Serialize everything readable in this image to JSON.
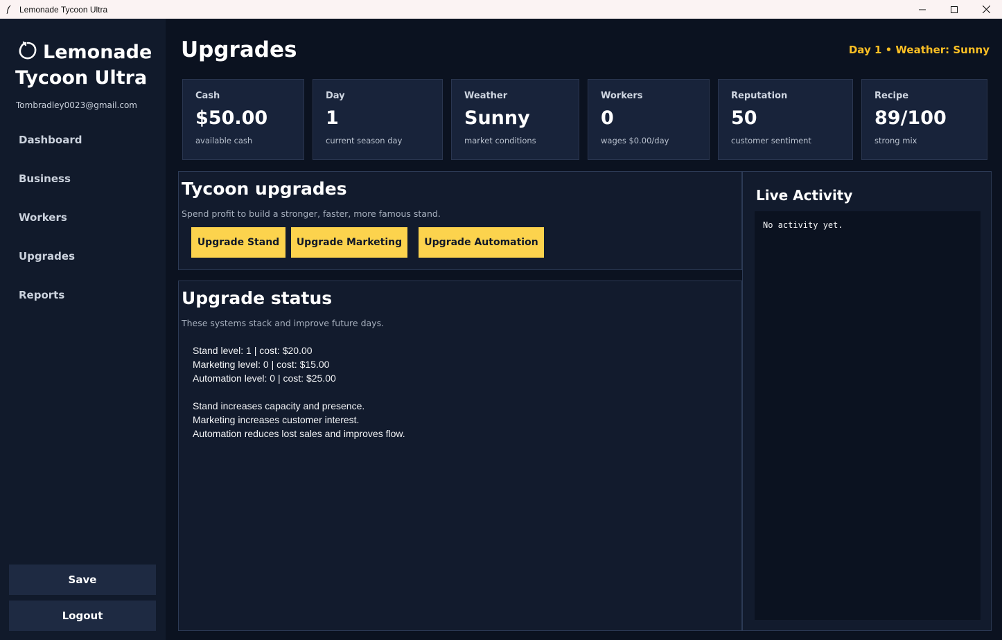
{
  "window": {
    "title": "Lemonade Tycoon Ultra"
  },
  "sidebar": {
    "brand": "Lemonade Tycoon Ultra",
    "email": "Tombradley0023@gmail.com",
    "nav": [
      {
        "label": "Dashboard"
      },
      {
        "label": "Business"
      },
      {
        "label": "Workers"
      },
      {
        "label": "Upgrades"
      },
      {
        "label": "Reports"
      }
    ],
    "save_label": "Save",
    "logout_label": "Logout"
  },
  "header": {
    "title": "Upgrades",
    "status": "Day 1 • Weather: Sunny"
  },
  "stats": [
    {
      "label": "Cash",
      "value": "$50.00",
      "sub": "available cash"
    },
    {
      "label": "Day",
      "value": "1",
      "sub": "current season day"
    },
    {
      "label": "Weather",
      "value": "Sunny",
      "sub": "market conditions"
    },
    {
      "label": "Workers",
      "value": "0",
      "sub": "wages $0.00/day"
    },
    {
      "label": "Reputation",
      "value": "50",
      "sub": "customer sentiment"
    },
    {
      "label": "Recipe",
      "value": "89/100",
      "sub": "strong mix"
    }
  ],
  "upgrades_panel": {
    "title": "Tycoon upgrades",
    "description": "Spend profit to build a stronger, faster, more famous stand.",
    "buttons": [
      {
        "label": "Upgrade Stand"
      },
      {
        "label": "Upgrade Marketing"
      },
      {
        "label": "Upgrade Automation"
      }
    ]
  },
  "status_panel": {
    "title": "Upgrade status",
    "description": "These systems stack and improve future days.",
    "lines": [
      "Stand level: 1  | cost: $20.00",
      "Marketing level: 0  | cost: $15.00",
      "Automation level: 0  | cost: $25.00",
      "",
      "Stand increases capacity and presence.",
      "Marketing increases customer interest.",
      "Automation reduces lost sales and improves flow."
    ]
  },
  "activity": {
    "title": "Live Activity",
    "log": "No activity yet."
  },
  "colors": {
    "accent": "#fcd34d",
    "status_text": "#fbbf24",
    "background": "#0b1220",
    "sidebar": "#111a2b",
    "card": "#18233a"
  }
}
